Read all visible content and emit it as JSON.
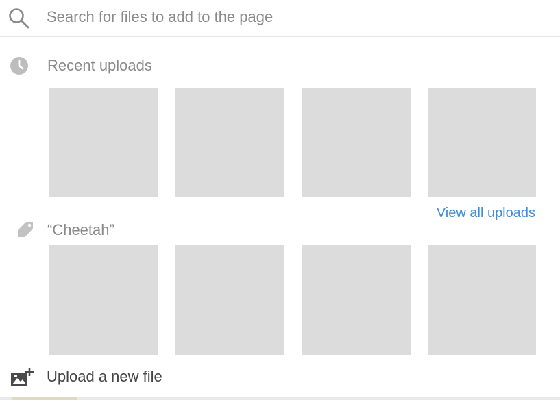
{
  "search": {
    "placeholder": "Search for files to add to the page",
    "icon": "search-icon"
  },
  "recent": {
    "title": "Recent uploads",
    "icon": "clock-icon",
    "thumbnail_count": 4
  },
  "view_all": {
    "label": "View all uploads"
  },
  "tag": {
    "title": "“Cheetah”",
    "icon": "tag-icon",
    "thumbnail_count": 4
  },
  "upload": {
    "label": "Upload a new file",
    "icon": "add-image-icon"
  },
  "colors": {
    "accent_link": "#3d8edb",
    "thumbnail_placeholder": "#dcdcdc",
    "muted_text": "#8a8a8a"
  }
}
